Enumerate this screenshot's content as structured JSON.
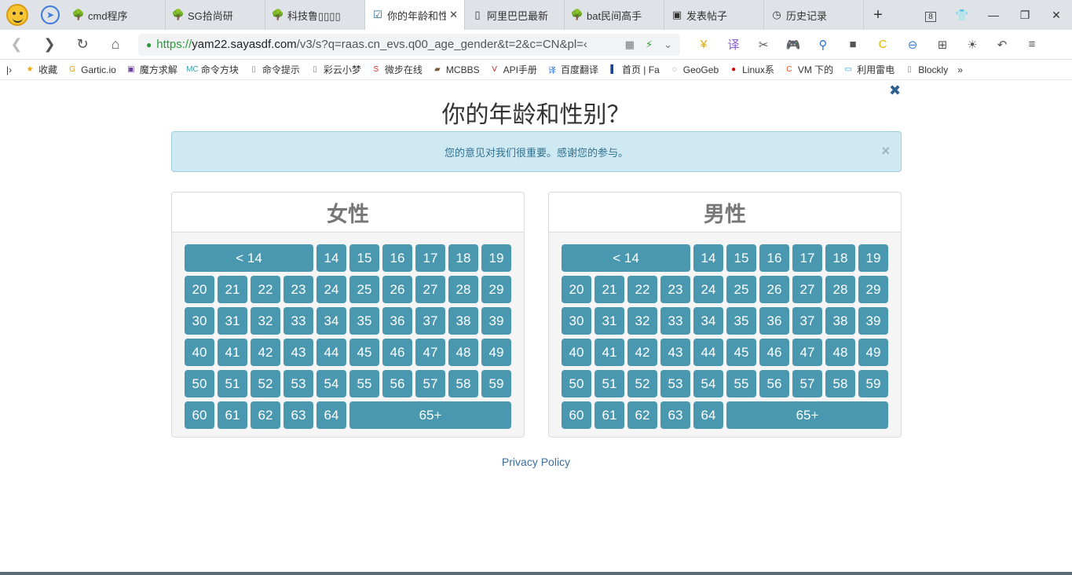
{
  "browser": {
    "tabs": [
      {
        "title": "cmd程序",
        "icon": "tree-icon"
      },
      {
        "title": "SG拾尚研",
        "icon": "tree-icon"
      },
      {
        "title": "科技鲁▯▯▯▯",
        "icon": "tree-icon"
      },
      {
        "title": "你的年龄和性",
        "icon": "check-icon",
        "active": true
      },
      {
        "title": "阿里巴巴最新",
        "icon": "page-icon"
      },
      {
        "title": "bat民间高手",
        "icon": "tree-icon"
      },
      {
        "title": "发表帖子",
        "icon": "box-icon"
      },
      {
        "title": "历史记录",
        "icon": "clock-icon"
      }
    ],
    "tab_counter": "8",
    "url": {
      "scheme": "https://",
      "host": "yam22.sayasdf.com",
      "path": "/v3/s?q=raas.cn_evs.q00_age_gender&t=2&c=CN&pl=‹"
    },
    "bookmarks": [
      {
        "label": "收藏",
        "icon": "star-icon"
      },
      {
        "label": "Gartic.io",
        "icon": "g-icon"
      },
      {
        "label": "魔方求解",
        "icon": "cube-icon"
      },
      {
        "label": "命令方块",
        "icon": "mc-icon"
      },
      {
        "label": "命令提示",
        "icon": "page-icon"
      },
      {
        "label": "彩云小梦",
        "icon": "page-icon"
      },
      {
        "label": "微步在线",
        "icon": "s-icon"
      },
      {
        "label": "MCBBS",
        "icon": "block-icon"
      },
      {
        "label": "API手册",
        "icon": "api-icon"
      },
      {
        "label": "百度翻译",
        "icon": "translate-icon"
      },
      {
        "label": "首页 | Fa",
        "icon": "flag-icon"
      },
      {
        "label": "GeoGeb",
        "icon": "geogebra-icon"
      },
      {
        "label": "Linux系",
        "icon": "redhat-icon"
      },
      {
        "label": "VM 下的",
        "icon": "c-icon"
      },
      {
        "label": "利用雷电",
        "icon": "bili-icon"
      },
      {
        "label": "Blockly",
        "icon": "page-icon"
      }
    ]
  },
  "survey": {
    "title": "你的年龄和性别？",
    "alert": "您的意见对我们很重要。感谢您的参与。",
    "female_label": "女性",
    "male_label": "男性",
    "ages": [
      "< 14",
      "14",
      "15",
      "16",
      "17",
      "18",
      "19",
      "20",
      "21",
      "22",
      "23",
      "24",
      "25",
      "26",
      "27",
      "28",
      "29",
      "30",
      "31",
      "32",
      "33",
      "34",
      "35",
      "36",
      "37",
      "38",
      "39",
      "40",
      "41",
      "42",
      "43",
      "44",
      "45",
      "46",
      "47",
      "48",
      "49",
      "50",
      "51",
      "52",
      "53",
      "54",
      "55",
      "56",
      "57",
      "58",
      "59",
      "60",
      "61",
      "62",
      "63",
      "64",
      "65+"
    ],
    "privacy": "Privacy Policy"
  },
  "colors": {
    "button": "#4a98b0",
    "alert_bg": "#cfe9f2",
    "link": "#3c6e9f"
  }
}
